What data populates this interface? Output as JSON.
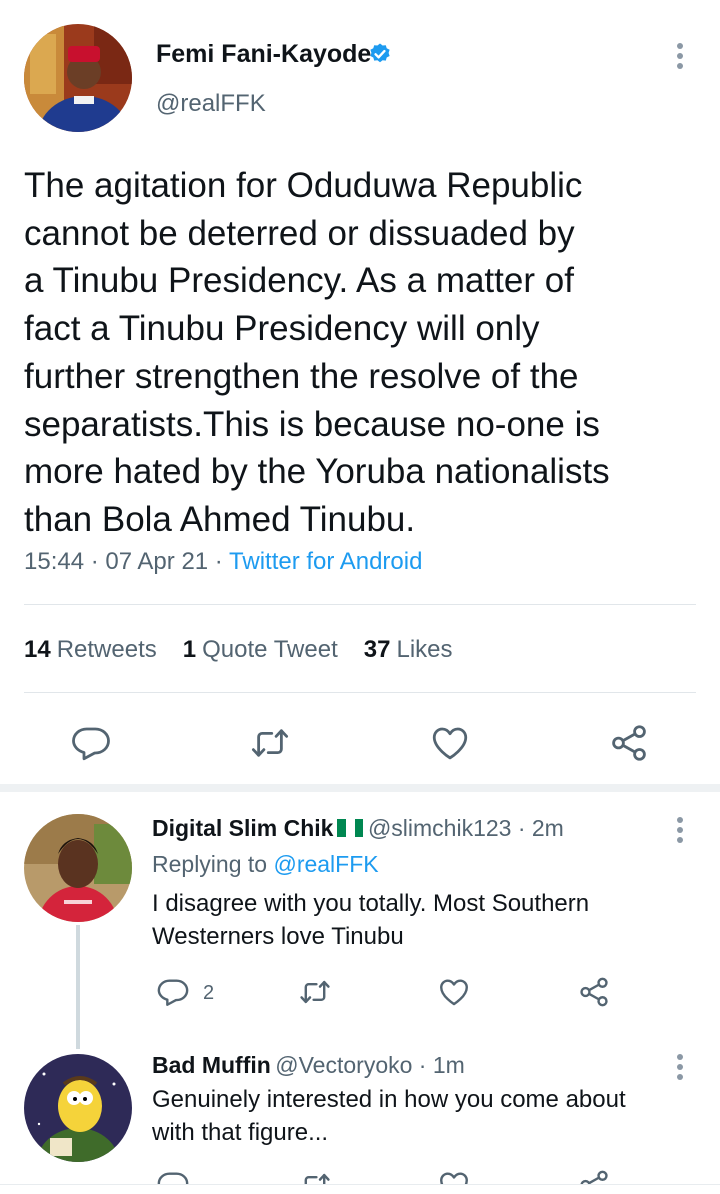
{
  "tweet": {
    "author_name": "Femi Fani-Kayode",
    "author_handle": "@realFFK",
    "text": "The agitation for Oduduwa Republic\ncannot be deterred or dissuaded by\na Tinubu Presidency. As a matter of\nfact a Tinubu Presidency will only\nfurther strengthen the resolve of the\nseparatists.This is because no-one is\nmore hated by the Yoruba nationalists\nthan Bola Ahmed Tinubu.",
    "time": "15:44 · 07 Apr 21 · ",
    "source": "Twitter for Android",
    "stats": {
      "retweets_count": "14",
      "retweets_label": "Retweets",
      "quotes_count": "1",
      "quotes_label": "Quote Tweet",
      "likes_count": "37",
      "likes_label": "Likes"
    }
  },
  "replies": [
    {
      "name": "Digital Slim Chik",
      "handle": "@slimchik123 · 2m",
      "replying_prefix": "Replying to ",
      "replying_to": "@realFFK",
      "text": "I disagree with you totally. Most Southern\nWesterners love Tinubu",
      "reply_count": "2"
    },
    {
      "name": "Bad Muffin",
      "handle": "@Vectoryoko · 1m",
      "text": "Genuinely interested in how you come about\nwith that figure..."
    }
  ],
  "colors": {
    "accent": "#1d9bf0",
    "secondary_text": "#536471",
    "icon_gray": "#536471"
  }
}
